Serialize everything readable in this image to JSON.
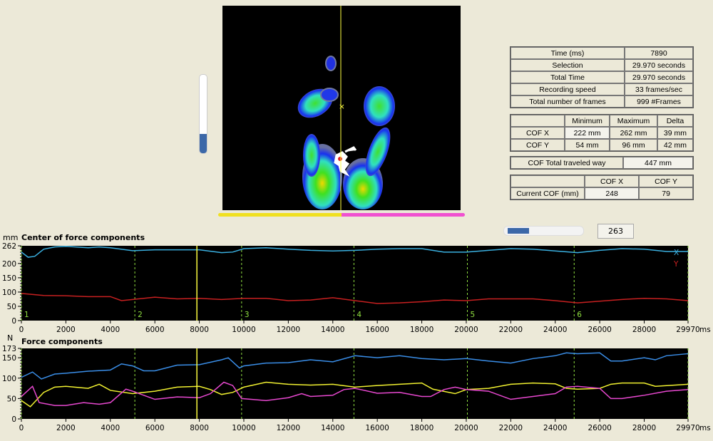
{
  "pressure_view": {
    "cursor_x_fraction": 0.5,
    "left_right_balance": {
      "left_fraction": 0.5,
      "left_color": "#f0e020",
      "right_color": "#f050d0"
    },
    "vertical_slider_level": 0.25
  },
  "info_table": {
    "rows": [
      {
        "label": "Time (ms)",
        "value": "7890"
      },
      {
        "label": "Selection",
        "value": "29.970 seconds"
      },
      {
        "label": "Total Time",
        "value": "29.970 seconds"
      },
      {
        "label": "Recording speed",
        "value": "33 frames/sec"
      },
      {
        "label": "Total number of frames",
        "value": "999 #Frames"
      }
    ]
  },
  "range_table": {
    "headers": [
      "",
      "Minimum",
      "Maximum",
      "Delta"
    ],
    "rows": [
      {
        "label": "COF X",
        "min": "222 mm",
        "max": "262 mm",
        "delta": "39 mm"
      },
      {
        "label": "COF Y",
        "min": "54 mm",
        "max": "96 mm",
        "delta": "42 mm"
      }
    ]
  },
  "traveled": {
    "label": "COF Total traveled way",
    "value": "447 mm"
  },
  "current_table": {
    "headers": [
      "",
      "COF X",
      "COF Y"
    ],
    "row": {
      "label": "Current COF (mm)",
      "x": "248",
      "y": "79"
    }
  },
  "playback": {
    "slider_level": 0.27,
    "value": "263"
  },
  "chart_data": [
    {
      "type": "line",
      "title": "Center of force components",
      "ylabel": "mm",
      "xlabel": "ms",
      "ylim": [
        0,
        262
      ],
      "xlim": [
        0,
        29970
      ],
      "yticks": [
        "0",
        "50",
        "100",
        "150",
        "200",
        "262"
      ],
      "xticks": [
        "0",
        "2000",
        "4000",
        "6000",
        "8000",
        "10000",
        "12000",
        "14000",
        "16000",
        "18000",
        "20000",
        "22000",
        "24000",
        "26000",
        "28000",
        "29970"
      ],
      "cursor": 7890,
      "markers": [
        {
          "x": 0,
          "label": "1"
        },
        {
          "x": 5100,
          "label": "2"
        },
        {
          "x": 9900,
          "label": "3"
        },
        {
          "x": 14950,
          "label": "4"
        },
        {
          "x": 20050,
          "label": "5"
        },
        {
          "x": 24850,
          "label": "6"
        },
        {
          "x": 29970,
          "label": ""
        }
      ],
      "series": [
        {
          "name": "X",
          "color": "#3ab0e0",
          "x": [
            0,
            300,
            600,
            1000,
            1500,
            2000,
            3000,
            3500,
            4000,
            5000,
            6000,
            7000,
            8000,
            9000,
            9500,
            10000,
            11000,
            12000,
            13000,
            14000,
            15000,
            16000,
            17000,
            18000,
            19000,
            20000,
            21000,
            22000,
            23000,
            24000,
            25000,
            26000,
            27000,
            28000,
            29000,
            29970
          ],
          "y": [
            240,
            222,
            225,
            250,
            258,
            260,
            255,
            258,
            255,
            245,
            248,
            248,
            248,
            238,
            240,
            252,
            255,
            250,
            246,
            244,
            246,
            250,
            252,
            252,
            240,
            240,
            246,
            252,
            250,
            244,
            238,
            246,
            252,
            250,
            242,
            242
          ]
        },
        {
          "name": "Y",
          "color": "#c82020",
          "x": [
            0,
            1000,
            2000,
            3000,
            4000,
            4500,
            5000,
            6000,
            7000,
            8000,
            9000,
            10000,
            11000,
            12000,
            13000,
            14000,
            15000,
            16000,
            17000,
            18000,
            19000,
            20000,
            21000,
            22000,
            23000,
            24000,
            25000,
            26000,
            27000,
            28000,
            29000,
            29970
          ],
          "y": [
            95,
            88,
            87,
            84,
            84,
            70,
            74,
            82,
            76,
            78,
            74,
            78,
            78,
            70,
            72,
            80,
            70,
            60,
            62,
            66,
            72,
            70,
            76,
            76,
            76,
            70,
            62,
            68,
            74,
            78,
            76,
            70
          ]
        }
      ]
    },
    {
      "type": "line",
      "title": "Force components",
      "ylabel": "N",
      "xlabel": "ms",
      "ylim": [
        0,
        173
      ],
      "xlim": [
        0,
        29970
      ],
      "yticks": [
        "0",
        "50",
        "100",
        "150",
        "173"
      ],
      "xticks": [
        "0",
        "2000",
        "4000",
        "6000",
        "8000",
        "10000",
        "12000",
        "14000",
        "16000",
        "18000",
        "20000",
        "22000",
        "24000",
        "26000",
        "28000",
        "29970"
      ],
      "cursor": 7890,
      "markers": [
        {
          "x": 0
        },
        {
          "x": 5100
        },
        {
          "x": 9900
        },
        {
          "x": 14950
        },
        {
          "x": 20050
        },
        {
          "x": 24850
        },
        {
          "x": 29970
        }
      ],
      "series": [
        {
          "color": "#3a8ee8",
          "x": [
            0,
            500,
            900,
            1500,
            2000,
            3000,
            4000,
            4500,
            5000,
            5500,
            6000,
            7000,
            8000,
            9000,
            9300,
            9800,
            10000,
            11000,
            12000,
            13000,
            14000,
            15000,
            16000,
            17000,
            18000,
            19000,
            20000,
            21000,
            22000,
            23000,
            24000,
            24500,
            25000,
            26000,
            26500,
            27000,
            28000,
            28500,
            29000,
            29970
          ],
          "y": [
            102,
            115,
            98,
            110,
            112,
            117,
            120,
            135,
            130,
            118,
            118,
            132,
            133,
            145,
            150,
            125,
            130,
            137,
            138,
            145,
            140,
            155,
            150,
            155,
            148,
            145,
            148,
            142,
            137,
            148,
            155,
            162,
            160,
            162,
            142,
            142,
            150,
            145,
            155,
            160
          ]
        },
        {
          "color": "#f0f030",
          "x": [
            0,
            400,
            1000,
            1500,
            2000,
            3000,
            3500,
            4000,
            5000,
            6000,
            7000,
            8000,
            8500,
            9000,
            9500,
            10000,
            11000,
            12000,
            13000,
            14000,
            15000,
            16000,
            17000,
            18000,
            18500,
            19500,
            20000,
            21000,
            22000,
            23000,
            24000,
            24500,
            25000,
            26000,
            26500,
            27000,
            28000,
            28500,
            29970
          ],
          "y": [
            45,
            30,
            65,
            78,
            80,
            75,
            85,
            70,
            62,
            68,
            78,
            80,
            72,
            60,
            65,
            78,
            90,
            85,
            83,
            85,
            78,
            82,
            85,
            88,
            73,
            62,
            72,
            75,
            85,
            88,
            86,
            75,
            73,
            75,
            85,
            88,
            88,
            80,
            85
          ]
        },
        {
          "color": "#e848d0",
          "x": [
            0,
            500,
            800,
            1500,
            2000,
            2800,
            3500,
            4000,
            4700,
            5000,
            6000,
            7000,
            8000,
            8500,
            9100,
            9500,
            9900,
            11000,
            12000,
            12600,
            13000,
            14000,
            14500,
            15000,
            16000,
            17000,
            18000,
            18400,
            19000,
            19500,
            20000,
            21000,
            22000,
            23000,
            24000,
            24500,
            25000,
            26000,
            26500,
            27000,
            28000,
            29000,
            29970
          ],
          "y": [
            55,
            80,
            40,
            33,
            33,
            40,
            36,
            40,
            73,
            68,
            48,
            54,
            52,
            62,
            90,
            82,
            50,
            45,
            52,
            62,
            55,
            58,
            72,
            75,
            63,
            65,
            55,
            55,
            72,
            78,
            72,
            68,
            48,
            55,
            62,
            78,
            80,
            75,
            50,
            50,
            58,
            68,
            72
          ]
        }
      ]
    }
  ]
}
